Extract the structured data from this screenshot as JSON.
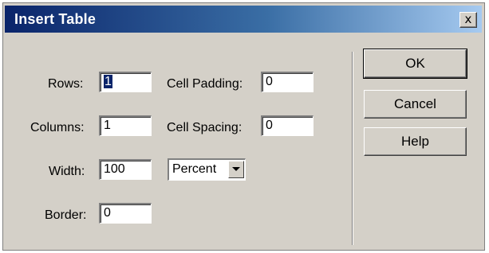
{
  "window": {
    "title": "Insert Table",
    "close_glyph": "x"
  },
  "form": {
    "rows_label": "Rows:",
    "rows_value": "1",
    "columns_label": "Columns:",
    "columns_value": "1",
    "width_label": "Width:",
    "width_value": "100",
    "width_unit": "Percent",
    "border_label": "Border:",
    "border_value": "0",
    "cell_padding_label": "Cell Padding:",
    "cell_padding_value": "0",
    "cell_spacing_label": "Cell Spacing:",
    "cell_spacing_value": "0"
  },
  "buttons": {
    "ok": "OK",
    "cancel": "Cancel",
    "help": "Help"
  },
  "colors": {
    "title_bar": "#0a246a",
    "dialog_face": "#d4d0c8",
    "selection": "#0a246a"
  }
}
